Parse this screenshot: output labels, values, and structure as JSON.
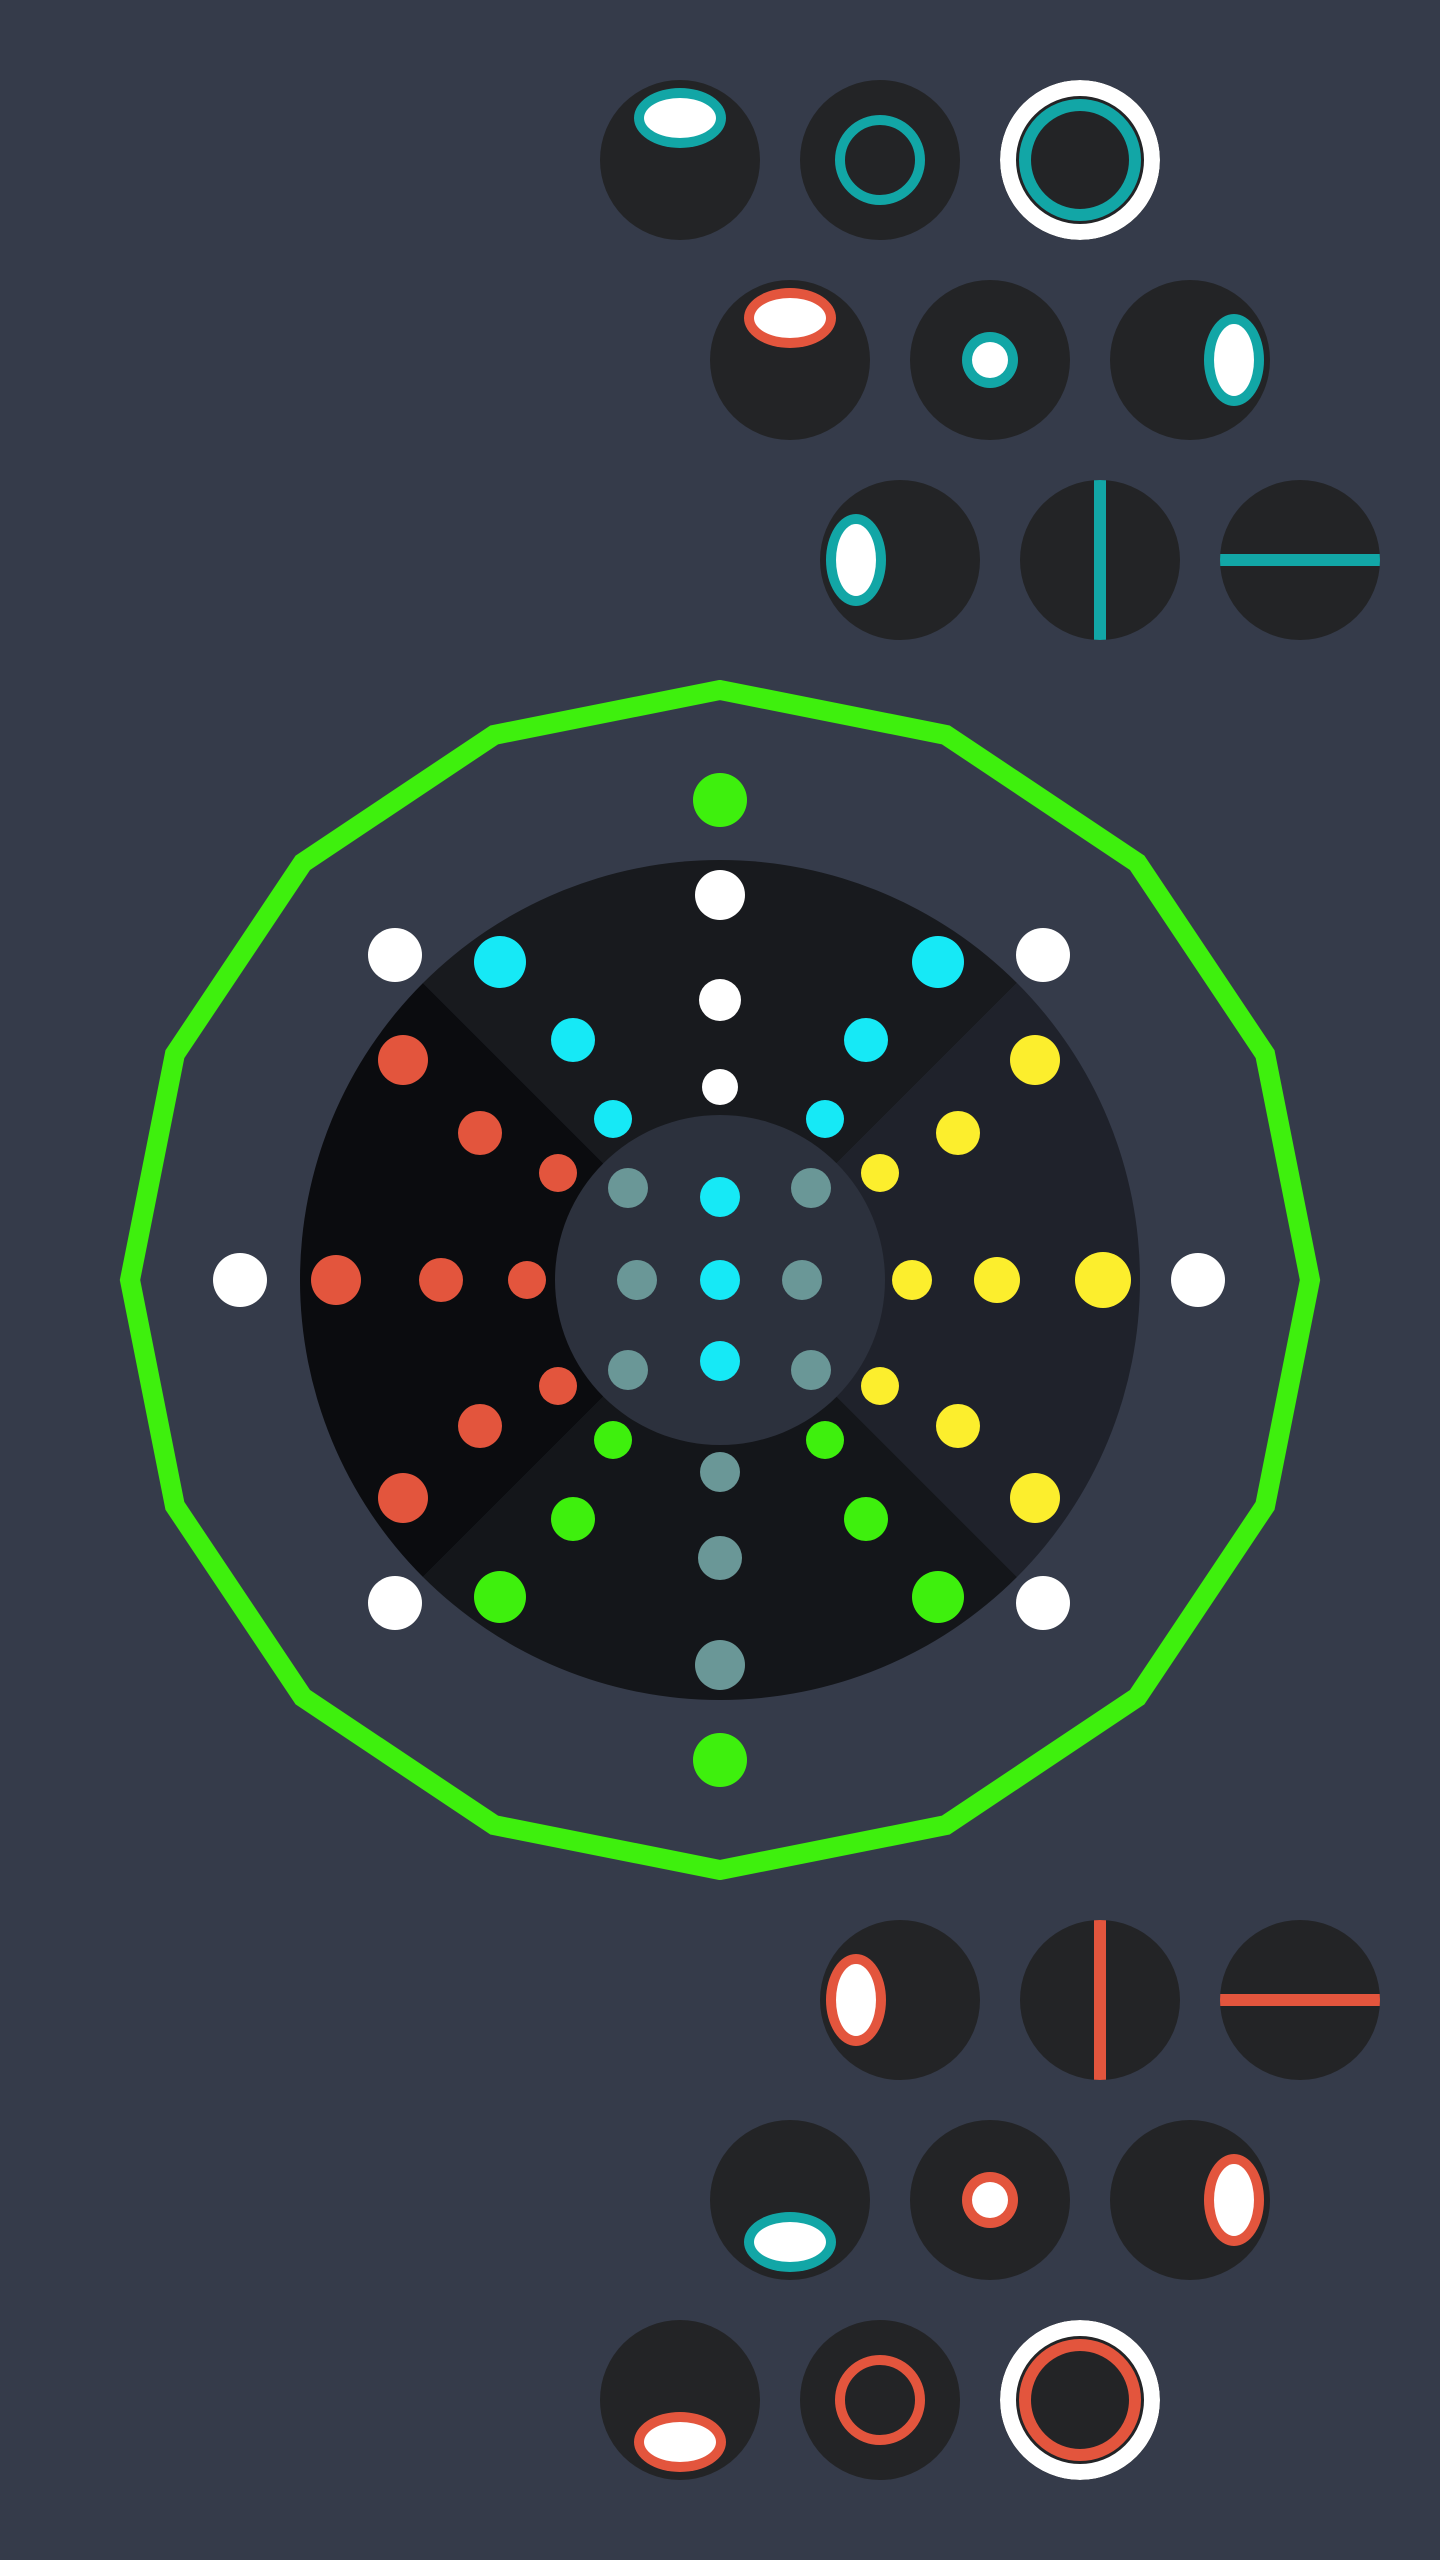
{
  "title": "",
  "colors": {
    "background": "#353b4a",
    "tile": "#232426",
    "teal": "#12a6a6",
    "red": "#e3553d",
    "white": "#ffffff",
    "green": "#3ef00d",
    "cyan": "#16e9f6",
    "yellow": "#fcee2d",
    "gray": "#6a9797",
    "orange": "#e3553d"
  },
  "top_controls": [
    [
      {
        "name": "teal-ellipse-top-icon",
        "icon": "ellipse-top",
        "color": "teal",
        "ring": false
      },
      {
        "name": "teal-ring-medium-icon",
        "icon": "ring-medium",
        "color": "teal",
        "ring": false
      },
      {
        "name": "teal-ring-large-icon",
        "icon": "ring-large",
        "color": "teal",
        "ring": true
      }
    ],
    [
      {
        "name": "red-ellipse-top-icon",
        "icon": "ellipse-top",
        "color": "red",
        "ring": false
      },
      {
        "name": "teal-ring-small-icon",
        "icon": "ring-small",
        "color": "teal",
        "ring": false
      },
      {
        "name": "teal-ellipse-right-icon",
        "icon": "ellipse-right",
        "color": "teal",
        "ring": false
      }
    ],
    [
      {
        "name": "teal-ellipse-left-icon",
        "icon": "ellipse-left",
        "color": "teal",
        "ring": false
      },
      {
        "name": "teal-vertical-line-icon",
        "icon": "line-vertical",
        "color": "teal",
        "ring": false
      },
      {
        "name": "teal-horizontal-line-icon",
        "icon": "line-horizontal",
        "color": "teal",
        "ring": false
      }
    ]
  ],
  "bottom_controls": [
    [
      {
        "name": "red-ellipse-left-icon",
        "icon": "ellipse-left",
        "color": "red",
        "ring": false
      },
      {
        "name": "red-vertical-line-icon",
        "icon": "line-vertical",
        "color": "red",
        "ring": false
      },
      {
        "name": "red-horizontal-line-icon",
        "icon": "line-horizontal",
        "color": "red",
        "ring": false
      }
    ],
    [
      {
        "name": "teal-ellipse-bottom-icon",
        "icon": "ellipse-bottom",
        "color": "teal",
        "ring": false
      },
      {
        "name": "red-ring-small-icon",
        "icon": "ring-small",
        "color": "red",
        "ring": false
      },
      {
        "name": "red-ellipse-right-icon",
        "icon": "ellipse-right",
        "color": "red",
        "ring": false
      }
    ],
    [
      {
        "name": "red-ellipse-bottom-icon",
        "icon": "ellipse-bottom",
        "color": "red",
        "ring": false
      },
      {
        "name": "red-ring-medium-icon",
        "icon": "ring-medium",
        "color": "red",
        "ring": false
      },
      {
        "name": "red-ring-large-icon",
        "icon": "ring-large",
        "color": "red",
        "ring": true
      }
    ]
  ],
  "board": {
    "outer_ring_sides": 16,
    "sectors": [
      {
        "name": "top",
        "color": "#181a1e"
      },
      {
        "name": "right",
        "color": "#1f222b"
      },
      {
        "name": "bottom",
        "color": "#14161a"
      },
      {
        "name": "left",
        "color": "#0b0c0f"
      }
    ],
    "center_color": "#2c313d",
    "pegs": [
      {
        "row": 0,
        "col": 0,
        "color": "green"
      },
      {
        "row": 1,
        "col": 0,
        "color": "white"
      },
      {
        "row": 2,
        "col": 0,
        "color": "white"
      },
      {
        "row": 3,
        "col": 0,
        "color": "white"
      },
      {
        "row": 1,
        "col": 1,
        "color": "white"
      },
      {
        "row": 2,
        "col": 1,
        "color": "cyan"
      },
      {
        "row": 3,
        "col": 1,
        "color": "cyan"
      },
      {
        "row": 4,
        "col": 1,
        "color": "cyan"
      },
      {
        "row": 1,
        "col": 7,
        "color": "white"
      },
      {
        "row": 2,
        "col": 7,
        "color": "cyan"
      },
      {
        "row": 3,
        "col": 7,
        "color": "cyan"
      },
      {
        "row": 4,
        "col": 7,
        "color": "cyan"
      },
      {
        "row": 1,
        "col": 2,
        "color": "white"
      },
      {
        "row": 2,
        "col": 2,
        "color": "yellow"
      },
      {
        "row": 3,
        "col": 2,
        "color": "yellow"
      },
      {
        "row": 4,
        "col": 2,
        "color": "yellow"
      },
      {
        "row": 5,
        "col": 2,
        "color": "yellow"
      },
      {
        "row": 1,
        "col": 3,
        "color": "white"
      },
      {
        "row": 2,
        "col": 3,
        "color": "yellow"
      },
      {
        "row": 3,
        "col": 3,
        "color": "yellow"
      },
      {
        "row": 4,
        "col": 3,
        "color": "yellow"
      },
      {
        "row": 1,
        "col": 4,
        "color": "white"
      },
      {
        "row": 2,
        "col": 4,
        "color": "green"
      },
      {
        "row": 3,
        "col": 4,
        "color": "green"
      },
      {
        "row": 4,
        "col": 4,
        "color": "green"
      },
      {
        "row": 0,
        "col": 4,
        "color": "green"
      },
      {
        "row": 2,
        "col": 5,
        "color": "gray"
      },
      {
        "row": 3,
        "col": 5,
        "color": "gray"
      },
      {
        "row": 4,
        "col": 5,
        "color": "gray"
      },
      {
        "row": 1,
        "col": 5,
        "color": "white"
      },
      {
        "row": 2,
        "col": 6,
        "color": "red"
      },
      {
        "row": 3,
        "col": 6,
        "color": "red"
      },
      {
        "row": 4,
        "col": 6,
        "color": "red"
      },
      {
        "row": 5,
        "col": 6,
        "color": "red"
      },
      {
        "row": 1,
        "col": 6,
        "color": "white"
      },
      {
        "row": 2,
        "col": 8,
        "color": "red"
      },
      {
        "row": 3,
        "col": 8,
        "color": "red"
      },
      {
        "row": 4,
        "col": 8,
        "color": "red"
      }
    ],
    "center_pegs": [
      {
        "pos": "top",
        "color": "cyan"
      },
      {
        "pos": "middle",
        "color": "cyan"
      },
      {
        "pos": "bottom",
        "color": "cyan"
      },
      {
        "pos": "left",
        "color": "gray"
      },
      {
        "pos": "right",
        "color": "gray"
      },
      {
        "pos": "top-left",
        "color": "gray"
      },
      {
        "pos": "top-right",
        "color": "gray"
      },
      {
        "pos": "bottom-left",
        "color": "gray"
      },
      {
        "pos": "bottom-right",
        "color": "gray"
      }
    ]
  }
}
